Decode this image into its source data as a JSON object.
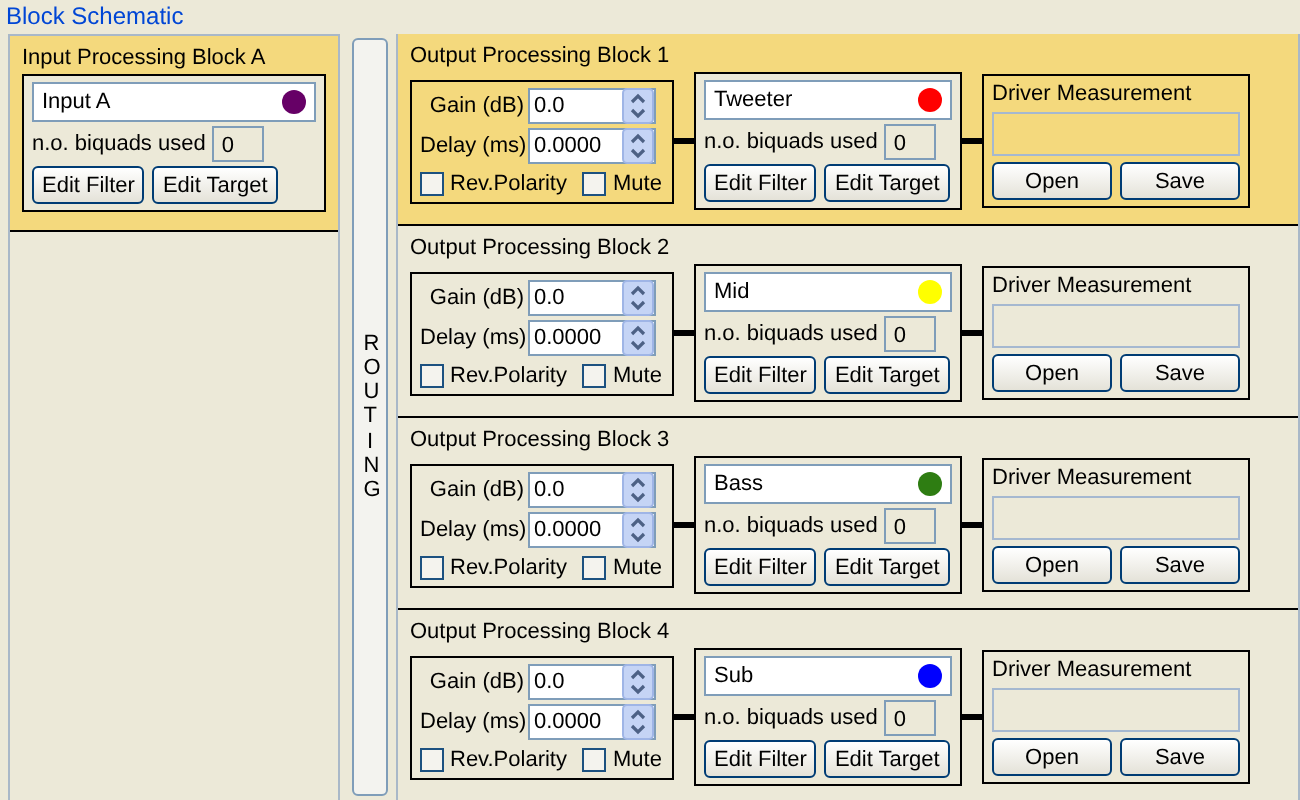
{
  "title": "Block Schematic",
  "input_block": {
    "title": "Input Processing Block A",
    "selected": true,
    "name": "Input A",
    "color": "#660066",
    "biquads_label": "n.o. biquads used",
    "biquads": "0",
    "buttons": [
      "Edit Filter",
      "Edit Target"
    ]
  },
  "routing": {
    "label": "ROUTING"
  },
  "output_blocks": [
    {
      "title": "Output Processing Block 1",
      "selected": true,
      "gain_label": "Gain (dB)",
      "gain": "0.0",
      "delay_label": "Delay (ms)",
      "delay": "0.0000",
      "checkboxes": [
        {
          "label": "Rev.Polarity",
          "checked": false
        },
        {
          "label": "Mute",
          "checked": false
        }
      ],
      "name": "Tweeter",
      "color": "#ff0000",
      "biquads_label": "n.o. biquads used",
      "biquads": "0",
      "filter_buttons": [
        "Edit Filter",
        "Edit Target"
      ],
      "measurement_title": "Driver Measurement",
      "measurement_buttons": [
        "Open",
        "Save"
      ]
    },
    {
      "title": "Output Processing Block 2",
      "selected": false,
      "gain_label": "Gain (dB)",
      "gain": "0.0",
      "delay_label": "Delay (ms)",
      "delay": "0.0000",
      "checkboxes": [
        {
          "label": "Rev.Polarity",
          "checked": false
        },
        {
          "label": "Mute",
          "checked": false
        }
      ],
      "name": "Mid",
      "color": "#ffff00",
      "biquads_label": "n.o. biquads used",
      "biquads": "0",
      "filter_buttons": [
        "Edit Filter",
        "Edit Target"
      ],
      "measurement_title": "Driver Measurement",
      "measurement_buttons": [
        "Open",
        "Save"
      ]
    },
    {
      "title": "Output Processing Block 3",
      "selected": false,
      "gain_label": "Gain (dB)",
      "gain": "0.0",
      "delay_label": "Delay (ms)",
      "delay": "0.0000",
      "checkboxes": [
        {
          "label": "Rev.Polarity",
          "checked": false
        },
        {
          "label": "Mute",
          "checked": false
        }
      ],
      "name": "Bass",
      "color": "#2e7d12",
      "biquads_label": "n.o. biquads used",
      "biquads": "0",
      "filter_buttons": [
        "Edit Filter",
        "Edit Target"
      ],
      "measurement_title": "Driver Measurement",
      "measurement_buttons": [
        "Open",
        "Save"
      ]
    },
    {
      "title": "Output Processing Block 4",
      "selected": false,
      "gain_label": "Gain (dB)",
      "gain": "0.0",
      "delay_label": "Delay (ms)",
      "delay": "0.0000",
      "checkboxes": [
        {
          "label": "Rev.Polarity",
          "checked": false
        },
        {
          "label": "Mute",
          "checked": false
        }
      ],
      "name": "Sub",
      "color": "#0000ff",
      "biquads_label": "n.o. biquads used",
      "biquads": "0",
      "filter_buttons": [
        "Edit Filter",
        "Edit Target"
      ],
      "measurement_title": "Driver Measurement",
      "measurement_buttons": [
        "Open",
        "Save"
      ]
    }
  ]
}
